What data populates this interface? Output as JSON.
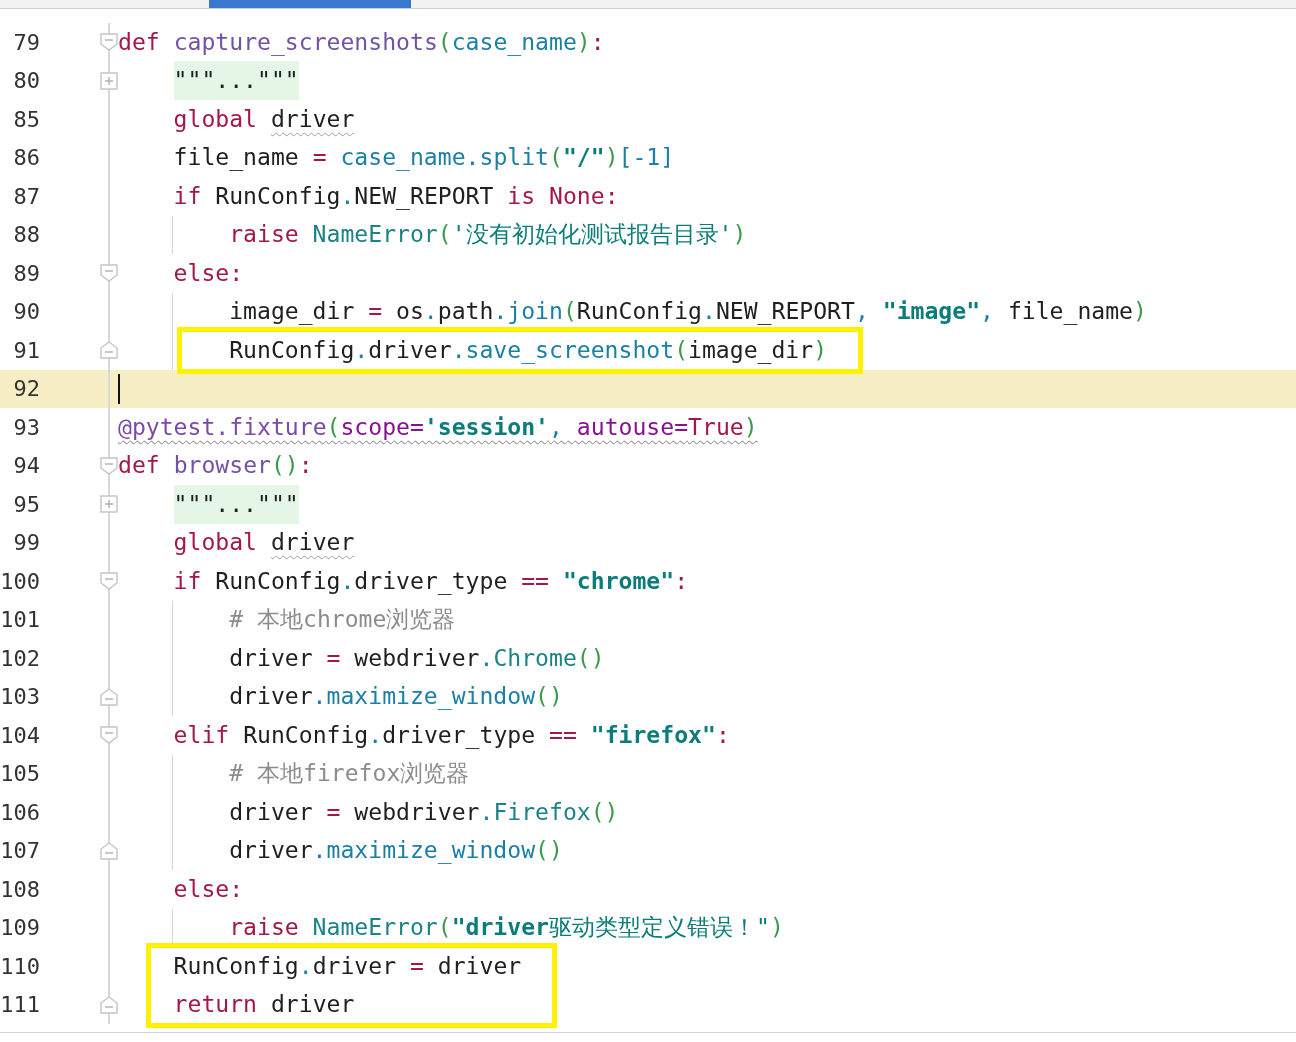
{
  "editor": {
    "lines": [
      {
        "number": "79",
        "kind": "fold_start",
        "tokens": [
          {
            "text": "def ",
            "kind": "kw"
          },
          {
            "text": "capture_screenshots",
            "kind": "fn"
          },
          {
            "text": "(",
            "kind": "paren"
          },
          {
            "text": "case_name",
            "kind": "param"
          },
          {
            "text": ")",
            "kind": "paren"
          },
          {
            "text": ":",
            "kind": "op"
          }
        ],
        "children": [
          {
            "number": "80",
            "kind": "folded",
            "tokens": [
              {
                "text": "\"\"\"...\"\"\"",
                "kind": "docstring"
              }
            ]
          },
          {
            "number": "85",
            "kind": "code",
            "tokens": [
              {
                "text": "global ",
                "kind": "kw"
              },
              {
                "text": "driver",
                "kind": "plain",
                "squiggle": true
              }
            ]
          },
          {
            "number": "86",
            "kind": "code",
            "tokens": [
              {
                "text": "file_name ",
                "kind": "plain"
              },
              {
                "text": "= ",
                "kind": "op"
              },
              {
                "text": "case_name",
                "kind": "param"
              },
              {
                "text": ".split",
                "kind": "call"
              },
              {
                "text": "(",
                "kind": "paren"
              },
              {
                "text": "\"/\"",
                "kind": "str"
              },
              {
                "text": ")",
                "kind": "paren"
              },
              {
                "text": "[-1]",
                "kind": "num"
              }
            ]
          },
          {
            "number": "87",
            "kind": "code",
            "tokens": [
              {
                "text": "if ",
                "kind": "kw"
              },
              {
                "text": "RunConfig",
                "kind": "plain"
              },
              {
                "text": ".",
                "kind": "dot"
              },
              {
                "text": "NEW_REPORT ",
                "kind": "plain"
              },
              {
                "text": "is None",
                "kind": "kw"
              },
              {
                "text": ":",
                "kind": "op"
              }
            ],
            "children": [
              {
                "number": "88",
                "kind": "code",
                "tokens": [
                  {
                    "text": "raise ",
                    "kind": "kw"
                  },
                  {
                    "text": "NameError",
                    "kind": "cls"
                  },
                  {
                    "text": "(",
                    "kind": "paren"
                  },
                  {
                    "text": "'没有初始化测试报告目录'",
                    "kind": "strcn"
                  },
                  {
                    "text": ")",
                    "kind": "paren"
                  }
                ]
              }
            ]
          },
          {
            "number": "89",
            "kind": "fold_start",
            "tokens": [
              {
                "text": "else",
                "kind": "kw"
              },
              {
                "text": ":",
                "kind": "op"
              }
            ],
            "children": [
              {
                "number": "90",
                "kind": "code",
                "tokens": [
                  {
                    "text": "image_dir ",
                    "kind": "plain"
                  },
                  {
                    "text": "= ",
                    "kind": "op"
                  },
                  {
                    "text": "os",
                    "kind": "plain"
                  },
                  {
                    "text": ".",
                    "kind": "dot"
                  },
                  {
                    "text": "path",
                    "kind": "plain"
                  },
                  {
                    "text": ".join",
                    "kind": "call"
                  },
                  {
                    "text": "(",
                    "kind": "paren"
                  },
                  {
                    "text": "RunConfig",
                    "kind": "plain"
                  },
                  {
                    "text": ".",
                    "kind": "dot"
                  },
                  {
                    "text": "NEW_REPORT",
                    "kind": "plain"
                  },
                  {
                    "text": ", ",
                    "kind": "dot"
                  },
                  {
                    "text": "\"image\"",
                    "kind": "str"
                  },
                  {
                    "text": ", ",
                    "kind": "dot"
                  },
                  {
                    "text": "file_name",
                    "kind": "plain"
                  },
                  {
                    "text": ")",
                    "kind": "paren"
                  }
                ]
              },
              {
                "number": "91",
                "kind": "fold_end",
                "boxed": true,
                "tokens": [
                  {
                    "text": "RunConfig",
                    "kind": "plain"
                  },
                  {
                    "text": ".",
                    "kind": "dot"
                  },
                  {
                    "text": "driver",
                    "kind": "plain"
                  },
                  {
                    "text": ".save_screenshot",
                    "kind": "call"
                  },
                  {
                    "text": "(",
                    "kind": "paren"
                  },
                  {
                    "text": "image_dir",
                    "kind": "plain"
                  },
                  {
                    "text": ")",
                    "kind": "paren"
                  }
                ]
              }
            ]
          }
        ]
      },
      {
        "number": "92",
        "kind": "code",
        "current": true
      },
      {
        "number": "93",
        "kind": "code",
        "squiggle": true,
        "tokens": [
          {
            "text": "@pytest.fixture",
            "kind": "dec"
          },
          {
            "text": "(",
            "kind": "paren"
          },
          {
            "text": "scope=",
            "kind": "kwarg"
          },
          {
            "text": "'session'",
            "kind": "str"
          },
          {
            "text": ", ",
            "kind": "dot"
          },
          {
            "text": "autouse=",
            "kind": "kwarg"
          },
          {
            "text": "True",
            "kind": "kw"
          },
          {
            "text": ")",
            "kind": "paren"
          }
        ]
      },
      {
        "number": "94",
        "kind": "fold_start",
        "tokens": [
          {
            "text": "def ",
            "kind": "kw"
          },
          {
            "text": "browser",
            "kind": "fn"
          },
          {
            "text": "()",
            "kind": "paren"
          },
          {
            "text": ":",
            "kind": "op"
          }
        ],
        "children": [
          {
            "number": "95",
            "kind": "folded",
            "tokens": [
              {
                "text": "\"\"\"...\"\"\"",
                "kind": "docstring"
              }
            ]
          },
          {
            "number": "99",
            "kind": "code",
            "tokens": [
              {
                "text": "global ",
                "kind": "kw"
              },
              {
                "text": "driver",
                "kind": "plain",
                "squiggle": true
              }
            ]
          },
          {
            "number": "100",
            "kind": "fold_start",
            "tokens": [
              {
                "text": "if ",
                "kind": "kw"
              },
              {
                "text": "RunConfig",
                "kind": "plain"
              },
              {
                "text": ".",
                "kind": "dot"
              },
              {
                "text": "driver_type ",
                "kind": "plain"
              },
              {
                "text": "== ",
                "kind": "op"
              },
              {
                "text": "\"chrome\"",
                "kind": "str"
              },
              {
                "text": ":",
                "kind": "op"
              }
            ],
            "children": [
              {
                "number": "101",
                "kind": "code",
                "tokens": [
                  {
                    "text": "# 本地chrome浏览器",
                    "kind": "comment"
                  }
                ]
              },
              {
                "number": "102",
                "kind": "code",
                "tokens": [
                  {
                    "text": "driver ",
                    "kind": "plain"
                  },
                  {
                    "text": "= ",
                    "kind": "op"
                  },
                  {
                    "text": "webdriver",
                    "kind": "plain"
                  },
                  {
                    "text": ".",
                    "kind": "dot"
                  },
                  {
                    "text": "Chrome",
                    "kind": "cls"
                  },
                  {
                    "text": "()",
                    "kind": "paren"
                  }
                ]
              },
              {
                "number": "103",
                "kind": "fold_end",
                "tokens": [
                  {
                    "text": "driver",
                    "kind": "plain"
                  },
                  {
                    "text": ".maximize_window",
                    "kind": "call"
                  },
                  {
                    "text": "()",
                    "kind": "paren"
                  }
                ]
              }
            ]
          },
          {
            "number": "104",
            "kind": "fold_start",
            "tokens": [
              {
                "text": "elif ",
                "kind": "kw"
              },
              {
                "text": "RunConfig",
                "kind": "plain"
              },
              {
                "text": ".",
                "kind": "dot"
              },
              {
                "text": "driver_type ",
                "kind": "plain"
              },
              {
                "text": "== ",
                "kind": "op"
              },
              {
                "text": "\"firefox\"",
                "kind": "str"
              },
              {
                "text": ":",
                "kind": "op"
              }
            ],
            "children": [
              {
                "number": "105",
                "kind": "code",
                "tokens": [
                  {
                    "text": "# 本地firefox浏览器",
                    "kind": "comment"
                  }
                ]
              },
              {
                "number": "106",
                "kind": "code",
                "tokens": [
                  {
                    "text": "driver ",
                    "kind": "plain"
                  },
                  {
                    "text": "= ",
                    "kind": "op"
                  },
                  {
                    "text": "webdriver",
                    "kind": "plain"
                  },
                  {
                    "text": ".",
                    "kind": "dot"
                  },
                  {
                    "text": "Firefox",
                    "kind": "cls"
                  },
                  {
                    "text": "()",
                    "kind": "paren"
                  }
                ]
              },
              {
                "number": "107",
                "kind": "fold_end",
                "tokens": [
                  {
                    "text": "driver",
                    "kind": "plain"
                  },
                  {
                    "text": ".maximize_window",
                    "kind": "call"
                  },
                  {
                    "text": "()",
                    "kind": "paren"
                  }
                ]
              }
            ]
          },
          {
            "number": "108",
            "kind": "code",
            "tokens": [
              {
                "text": "else",
                "kind": "kw"
              },
              {
                "text": ":",
                "kind": "op"
              }
            ],
            "children": [
              {
                "number": "109",
                "kind": "code",
                "tokens": [
                  {
                    "text": "raise ",
                    "kind": "kw"
                  },
                  {
                    "text": "NameError",
                    "kind": "cls"
                  },
                  {
                    "text": "(",
                    "kind": "paren"
                  },
                  {
                    "text": "\"driver",
                    "kind": "str"
                  },
                  {
                    "text": "驱动类型定义错误！\"",
                    "kind": "strcn"
                  },
                  {
                    "text": ")",
                    "kind": "paren"
                  }
                ]
              }
            ]
          },
          {
            "number": "110",
            "kind": "code",
            "boxed": true,
            "tokens": [
              {
                "text": "RunConfig",
                "kind": "plain"
              },
              {
                "text": ".",
                "kind": "dot"
              },
              {
                "text": "driver ",
                "kind": "plain"
              },
              {
                "text": "= ",
                "kind": "op"
              },
              {
                "text": "driver",
                "kind": "plain"
              }
            ]
          },
          {
            "number": "111",
            "kind": "fold_end",
            "boxed": true,
            "tokens": [
              {
                "text": "return ",
                "kind": "kw"
              },
              {
                "text": "driver",
                "kind": "plain"
              }
            ]
          }
        ]
      }
    ]
  }
}
